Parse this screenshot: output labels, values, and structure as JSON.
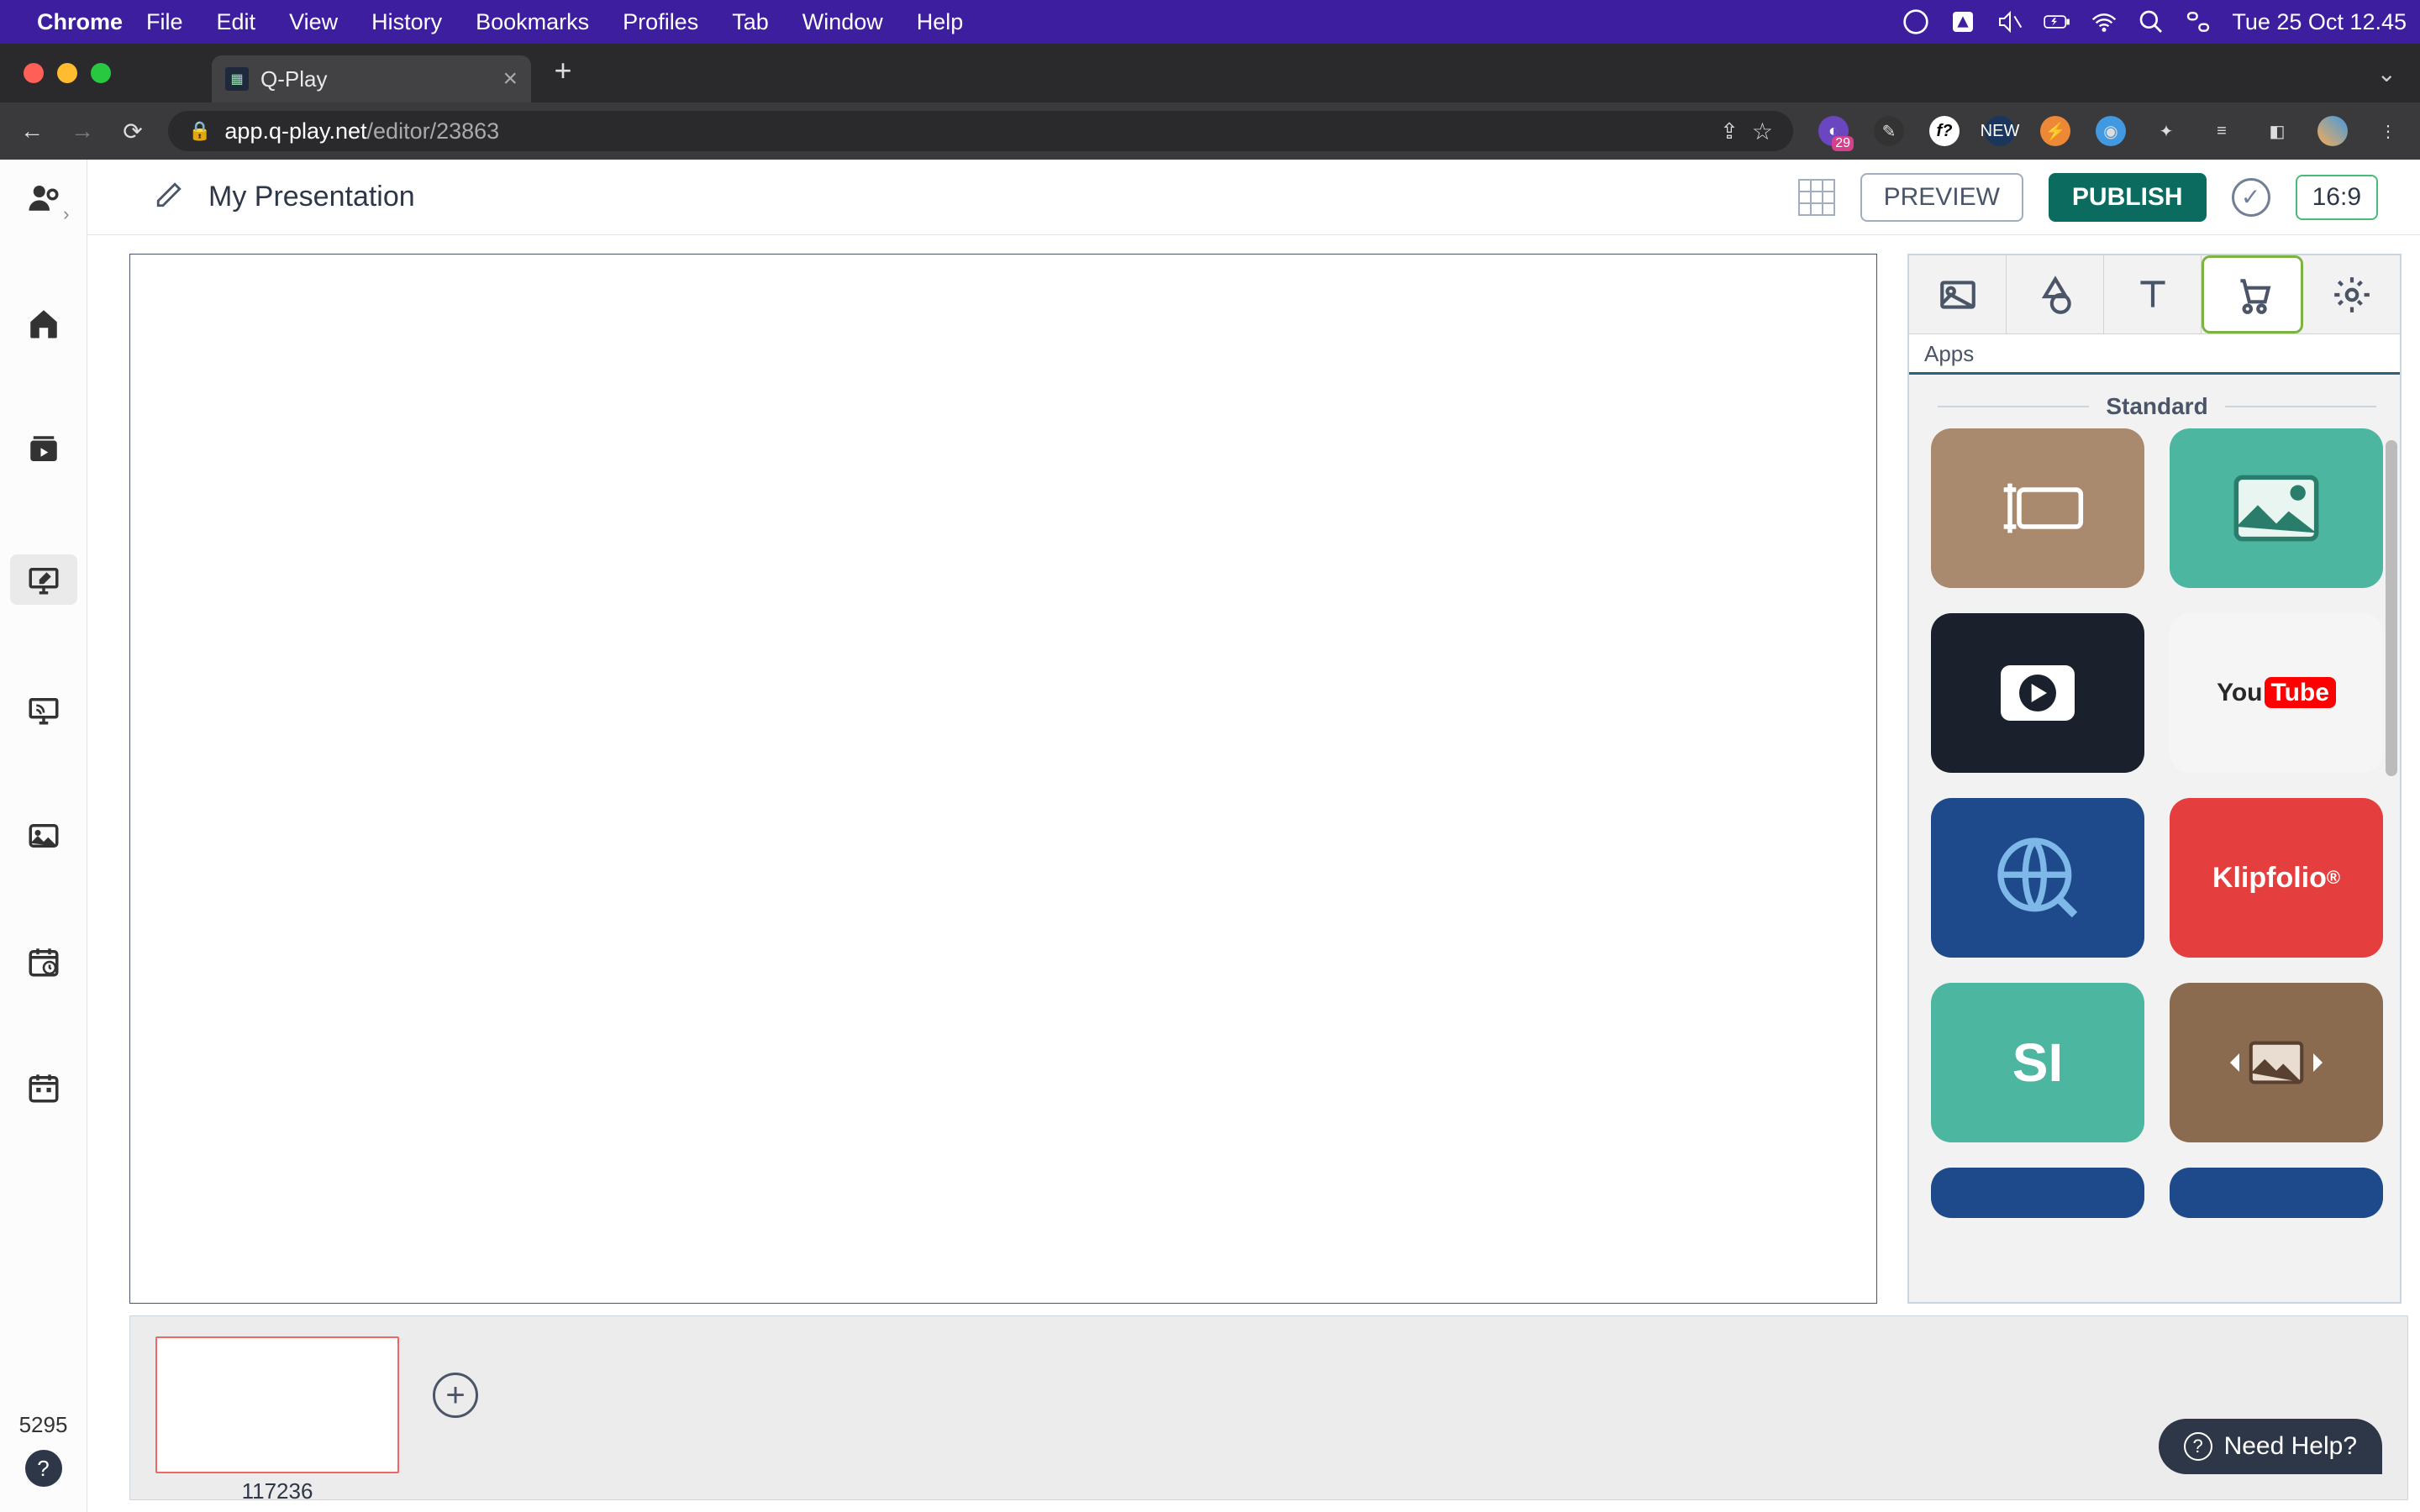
{
  "menubar": {
    "app": "Chrome",
    "items": [
      "File",
      "Edit",
      "View",
      "History",
      "Bookmarks",
      "Profiles",
      "Tab",
      "Window",
      "Help"
    ],
    "clock": "Tue 25 Oct  12.45"
  },
  "browser": {
    "tab_title": "Q-Play",
    "url_host": "app.q-play.net",
    "url_path": "/editor/23863",
    "ext_badge": "29",
    "ext_new": "NEW"
  },
  "topbar": {
    "presentation_title": "My Presentation",
    "preview": "PREVIEW",
    "publish": "PUBLISH",
    "aspect": "16:9"
  },
  "left_rail": {
    "counter": "5295"
  },
  "right_panel": {
    "tab_label": "Apps",
    "section": "Standard",
    "tiles": {
      "youtube_a": "You",
      "youtube_b": "Tube",
      "klipfolio": "Klipfolio",
      "si": "SI"
    }
  },
  "tray": {
    "slide_id": "117236"
  },
  "help": {
    "label": "Need Help?"
  }
}
